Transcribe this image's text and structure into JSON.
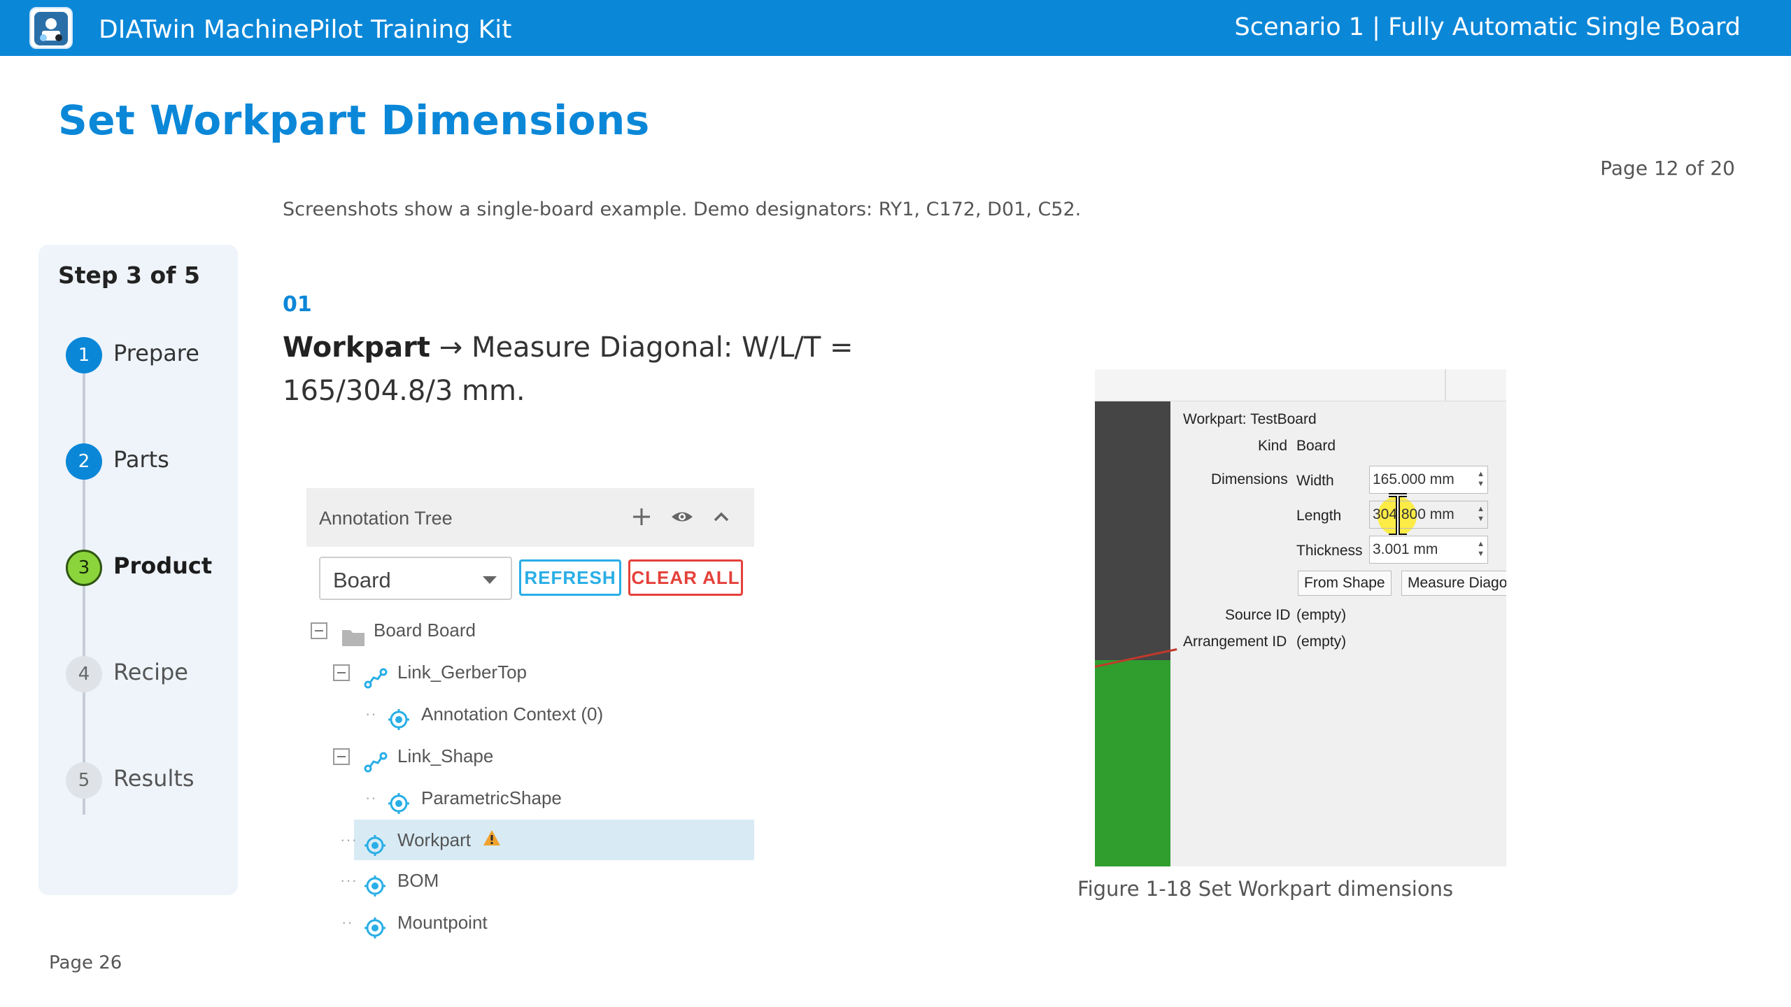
{
  "header": {
    "app_title": "DIATwin MachinePilot Training Kit",
    "scenario": "Scenario 1 | Fully Automatic Single Board"
  },
  "page_title": "Set Workpart Dimensions",
  "page_indicator": "Page 12 of 20",
  "note": "Screenshots show a single-board example. Demo designators: RY1, C172, D01, C52.",
  "stepper": {
    "title": "Step 3 of 5",
    "steps": [
      {
        "number": "1",
        "label": "Prepare",
        "state": "done"
      },
      {
        "number": "2",
        "label": "Parts",
        "state": "done"
      },
      {
        "number": "3",
        "label": "Product",
        "state": "current"
      },
      {
        "number": "4",
        "label": "Recipe",
        "state": "todo"
      },
      {
        "number": "5",
        "label": "Results",
        "state": "todo"
      }
    ]
  },
  "instruction": {
    "number": "01",
    "bold": "Workpart",
    "arrow": "→",
    "text_line1": "Measure Diagonal: W/L/T =",
    "text_line2": "165/304.8/3 mm."
  },
  "annotation_tree": {
    "title": "Annotation Tree",
    "select_value": "Board",
    "refresh_label": "REFRESH",
    "clear_label": "CLEAR ALL",
    "rows": [
      {
        "label": "Board  Board",
        "icon": "folder-icon",
        "expander": true
      },
      {
        "label": "Link_GerberTop",
        "icon": "link-icon",
        "expander": true
      },
      {
        "label": "Annotation Context (0)",
        "icon": "target-icon",
        "expander": false
      },
      {
        "label": "Link_Shape",
        "icon": "link-icon",
        "expander": true
      },
      {
        "label": "ParametricShape",
        "icon": "target-icon",
        "expander": false
      },
      {
        "label": "Workpart",
        "icon": "target-icon",
        "expander": false,
        "selected": true,
        "warning": true
      },
      {
        "label": "BOM",
        "icon": "target-icon",
        "expander": false
      },
      {
        "label": "Mountpoint",
        "icon": "target-icon",
        "expander": false
      }
    ]
  },
  "properties": {
    "workpart_label": "Workpart: TestBoard",
    "kind_label": "Kind",
    "kind_value": "Board",
    "dimensions_label": "Dimensions",
    "width_label": "Width",
    "width_value": "165.000 mm",
    "length_label": "Length",
    "length_value": "304.800 mm",
    "thickness_label": "Thickness",
    "thickness_value": "3.001 mm",
    "from_shape_label": "From Shape",
    "measure_label": "Measure Diagor",
    "source_label": "Source ID",
    "source_value": "(empty)",
    "arrangement_label": "Arrangement ID",
    "arrangement_value": "(empty)"
  },
  "caption": "Figure 1-18  Set Workpart dimensions",
  "footer_page": "Page 26",
  "colors": {
    "brand_blue": "#0b87d8",
    "current_step_green": "#8bd43c",
    "refresh_cyan": "#29aee6",
    "clear_red": "#e5403a"
  }
}
